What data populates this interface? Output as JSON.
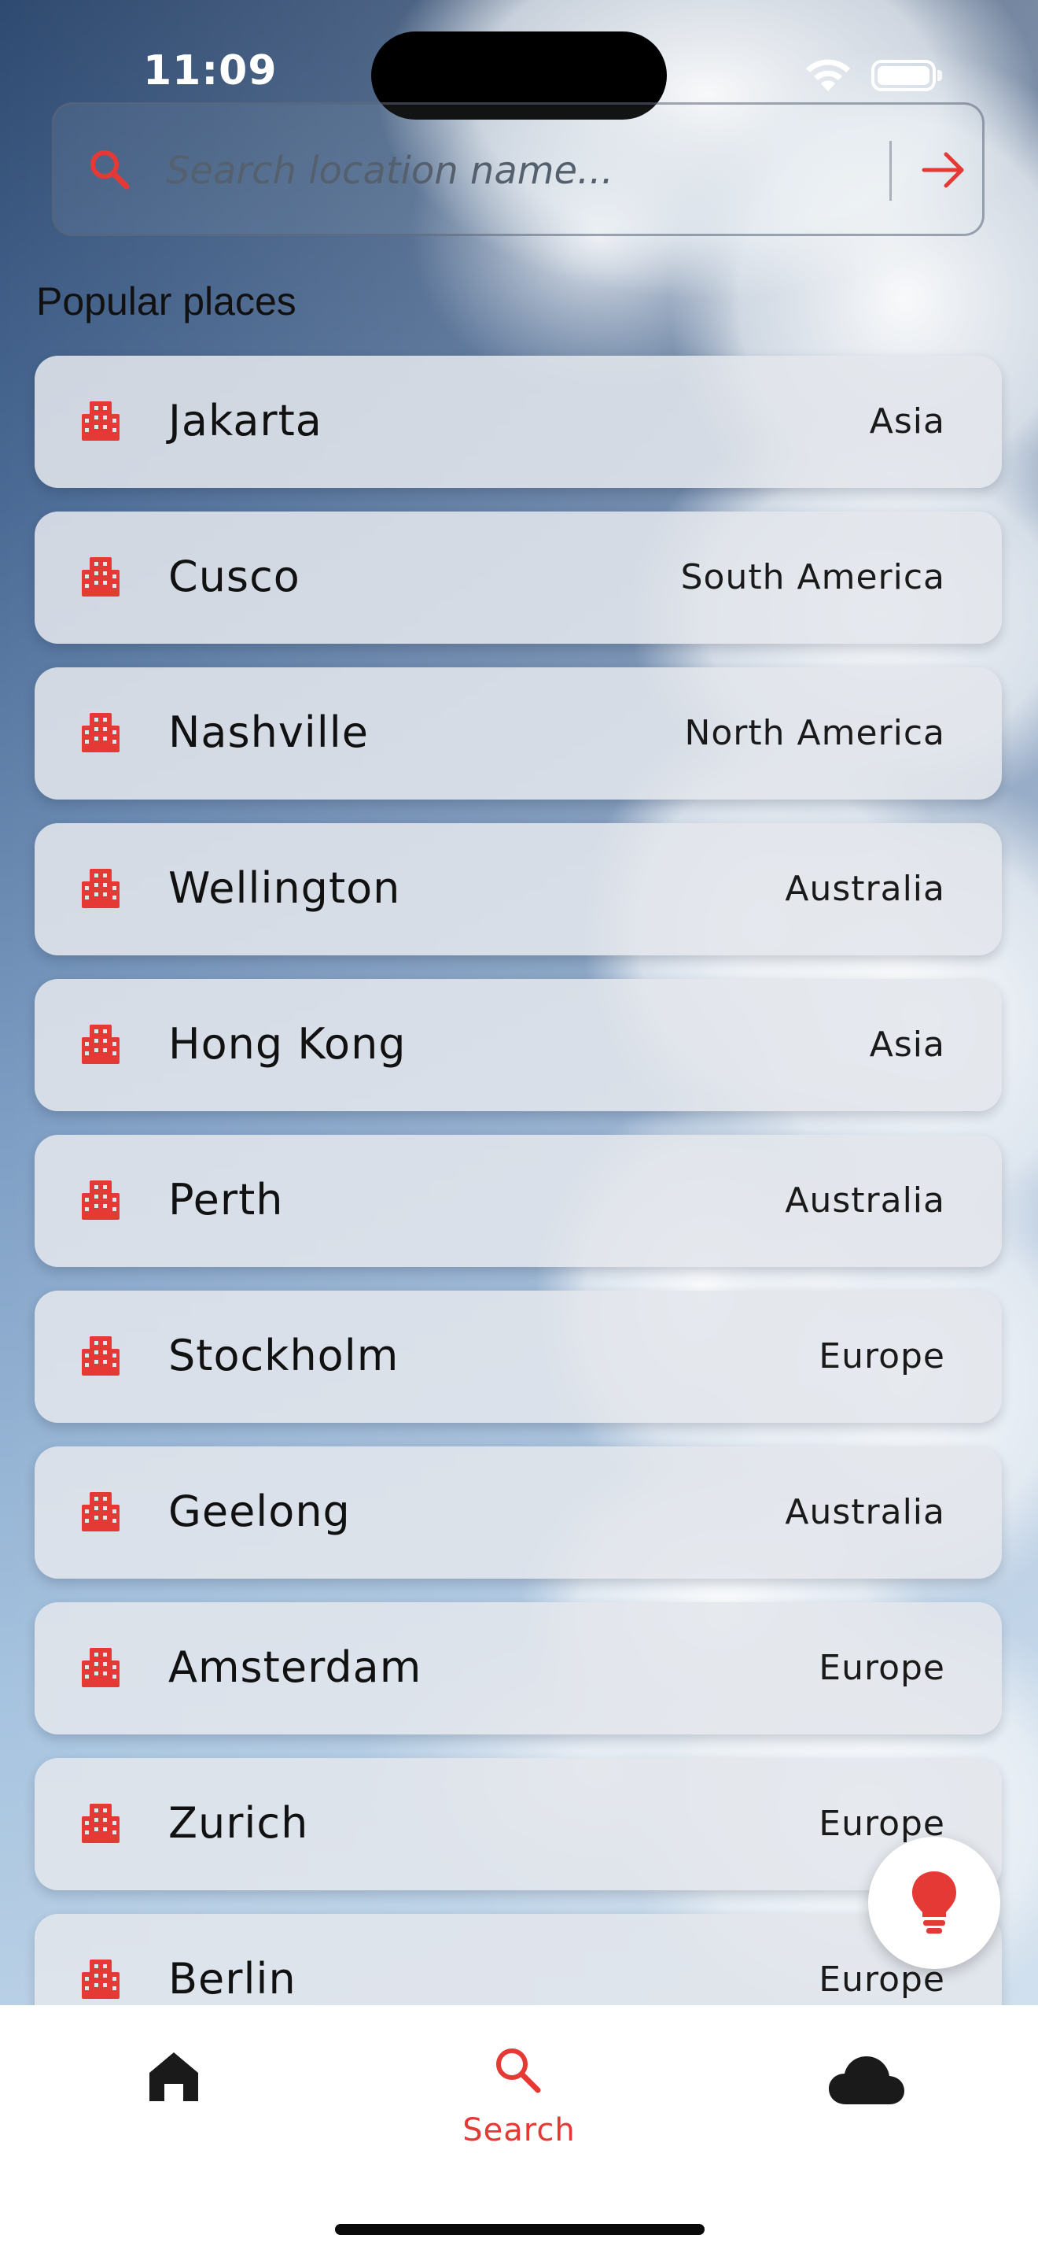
{
  "status_bar": {
    "time": "11:09"
  },
  "search": {
    "placeholder": "Search location name..."
  },
  "section_title": "Popular places",
  "places": [
    {
      "name": "Jakarta",
      "region": "Asia"
    },
    {
      "name": "Cusco",
      "region": "South America"
    },
    {
      "name": "Nashville",
      "region": "North America"
    },
    {
      "name": "Wellington",
      "region": "Australia"
    },
    {
      "name": "Hong Kong",
      "region": "Asia"
    },
    {
      "name": "Perth",
      "region": "Australia"
    },
    {
      "name": "Stockholm",
      "region": "Europe"
    },
    {
      "name": "Geelong",
      "region": "Australia"
    },
    {
      "name": "Amsterdam",
      "region": "Europe"
    },
    {
      "name": "Zurich",
      "region": "Europe"
    },
    {
      "name": "Berlin",
      "region": "Europe"
    }
  ],
  "icons": {
    "search": "search-icon",
    "submit": "arrow-right-icon",
    "place": "city-building-icon",
    "fab": "lightbulb-icon",
    "nav_home": "home-icon",
    "nav_search": "search-icon",
    "nav_weather": "cloud-icon"
  },
  "bottom_nav": {
    "items": [
      {
        "icon": "home-icon",
        "label": ""
      },
      {
        "icon": "search-icon",
        "label": "Search",
        "active": true
      },
      {
        "icon": "cloud-icon",
        "label": ""
      }
    ]
  },
  "colors": {
    "accent": "#e53935",
    "card_background": "#e2e6ec",
    "nav_background": "#ffffff",
    "inactive_icon": "#1a1a1a"
  }
}
